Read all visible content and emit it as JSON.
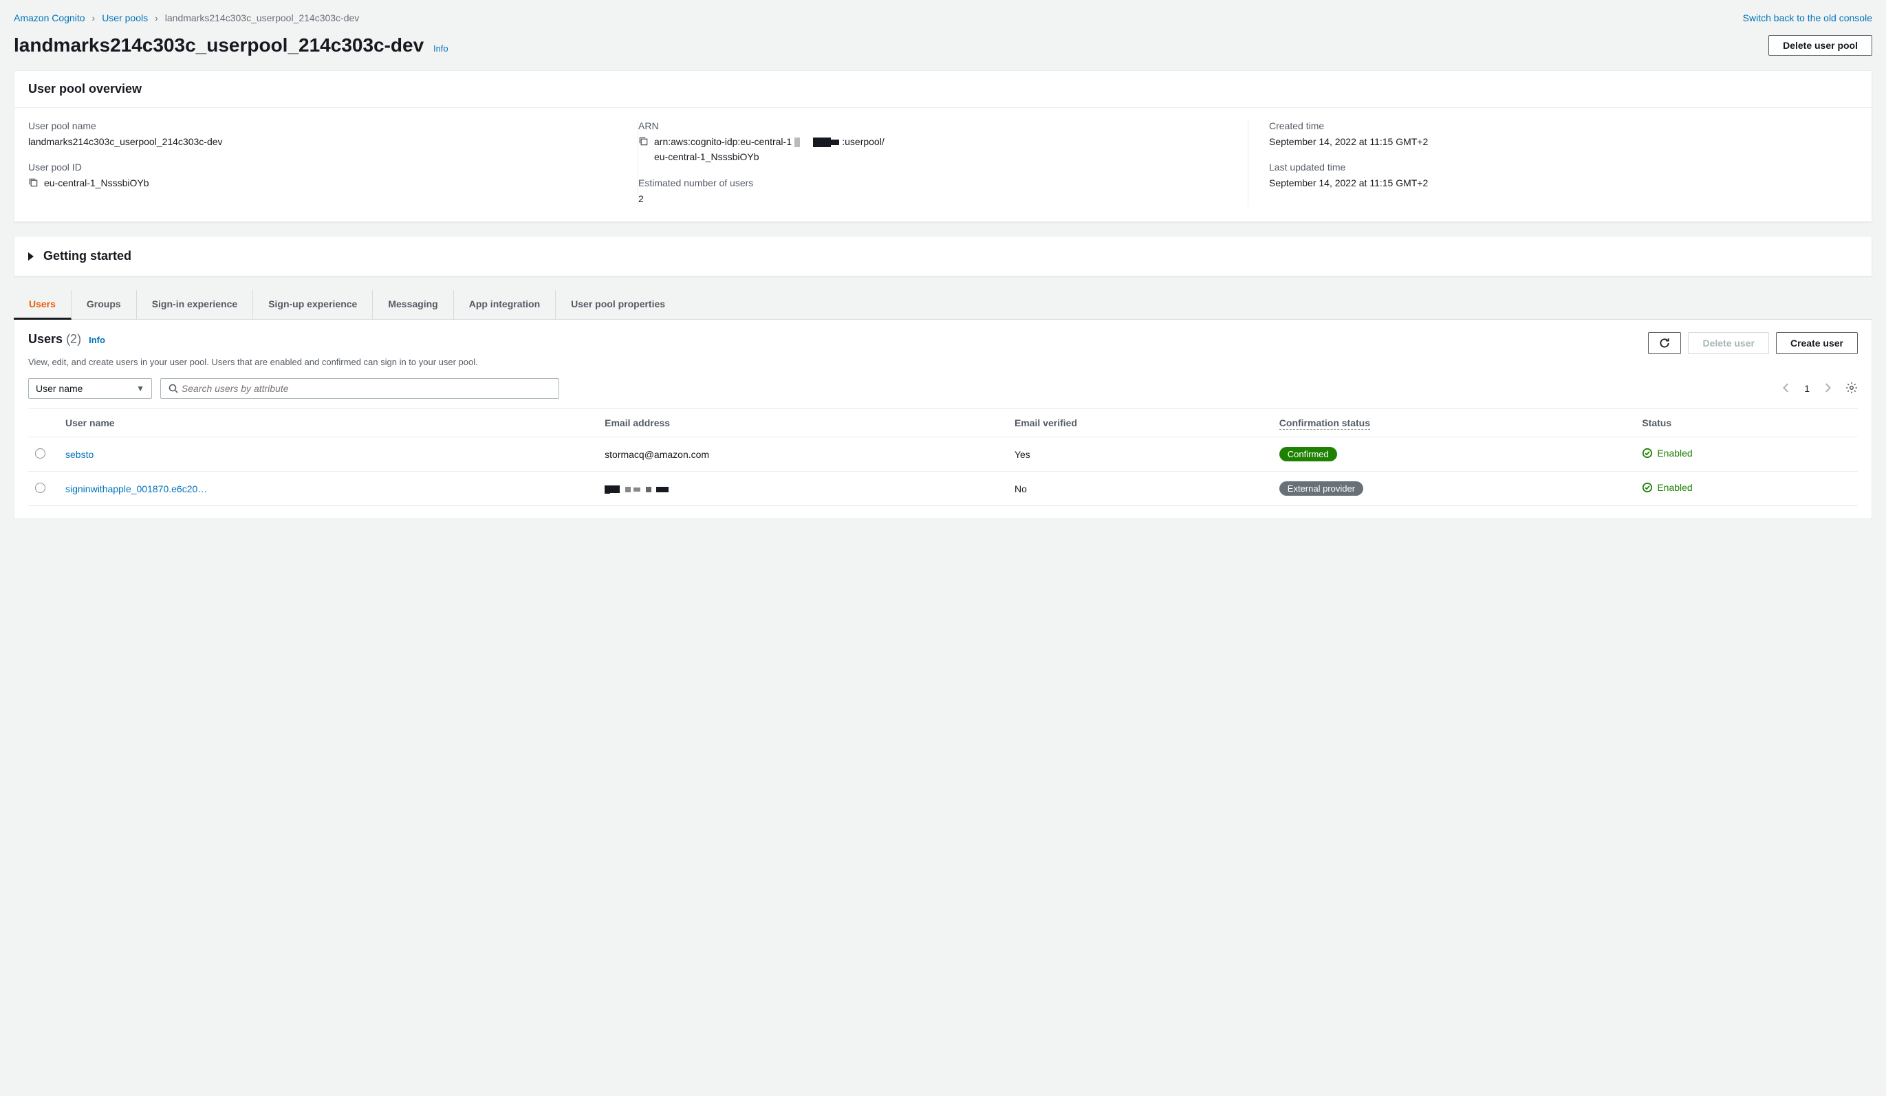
{
  "breadcrumb": {
    "root": "Amazon Cognito",
    "level2": "User pools",
    "current": "landmarks214c303c_userpool_214c303c-dev"
  },
  "switch_back": "Switch back to the old console",
  "title": "landmarks214c303c_userpool_214c303c-dev",
  "title_info": "Info",
  "delete_pool_btn": "Delete user pool",
  "overview": {
    "header": "User pool overview",
    "name_label": "User pool name",
    "name_value": "landmarks214c303c_userpool_214c303c-dev",
    "id_label": "User pool ID",
    "id_value": "eu-central-1_NsssbiOYb",
    "arn_label": "ARN",
    "arn_prefix": "arn:aws:cognito-idp:eu-central-1",
    "arn_mid": ":userpool/",
    "arn_line2": "eu-central-1_NsssbiOYb",
    "users_label": "Estimated number of users",
    "users_value": "2",
    "created_label": "Created time",
    "created_value": "September 14, 2022 at 11:15 GMT+2",
    "updated_label": "Last updated time",
    "updated_value": "September 14, 2022 at 11:15 GMT+2"
  },
  "getting_started": "Getting started",
  "tabs": {
    "users": "Users",
    "groups": "Groups",
    "signin": "Sign-in experience",
    "signup": "Sign-up experience",
    "messaging": "Messaging",
    "appint": "App integration",
    "props": "User pool properties"
  },
  "users_section": {
    "heading": "Users",
    "count": "(2)",
    "info": "Info",
    "desc": "View, edit, and create users in your user pool. Users that are enabled and confirmed can sign in to your user pool.",
    "delete_btn": "Delete user",
    "create_btn": "Create user",
    "filter_attr": "User name",
    "search_placeholder": "Search users by attribute",
    "page": "1",
    "cols": {
      "username": "User name",
      "email": "Email address",
      "verified": "Email verified",
      "confirmation": "Confirmation status",
      "status": "Status"
    },
    "rows": [
      {
        "username": "sebsto",
        "email": "stormacq@amazon.com",
        "email_redacted": false,
        "verified": "Yes",
        "confirmation": "Confirmed",
        "confirmation_style": "green",
        "status": "Enabled"
      },
      {
        "username": "signinwithapple_001870.e6c20…",
        "email": "",
        "email_redacted": true,
        "verified": "No",
        "confirmation": "External provider",
        "confirmation_style": "gray",
        "status": "Enabled"
      }
    ]
  }
}
